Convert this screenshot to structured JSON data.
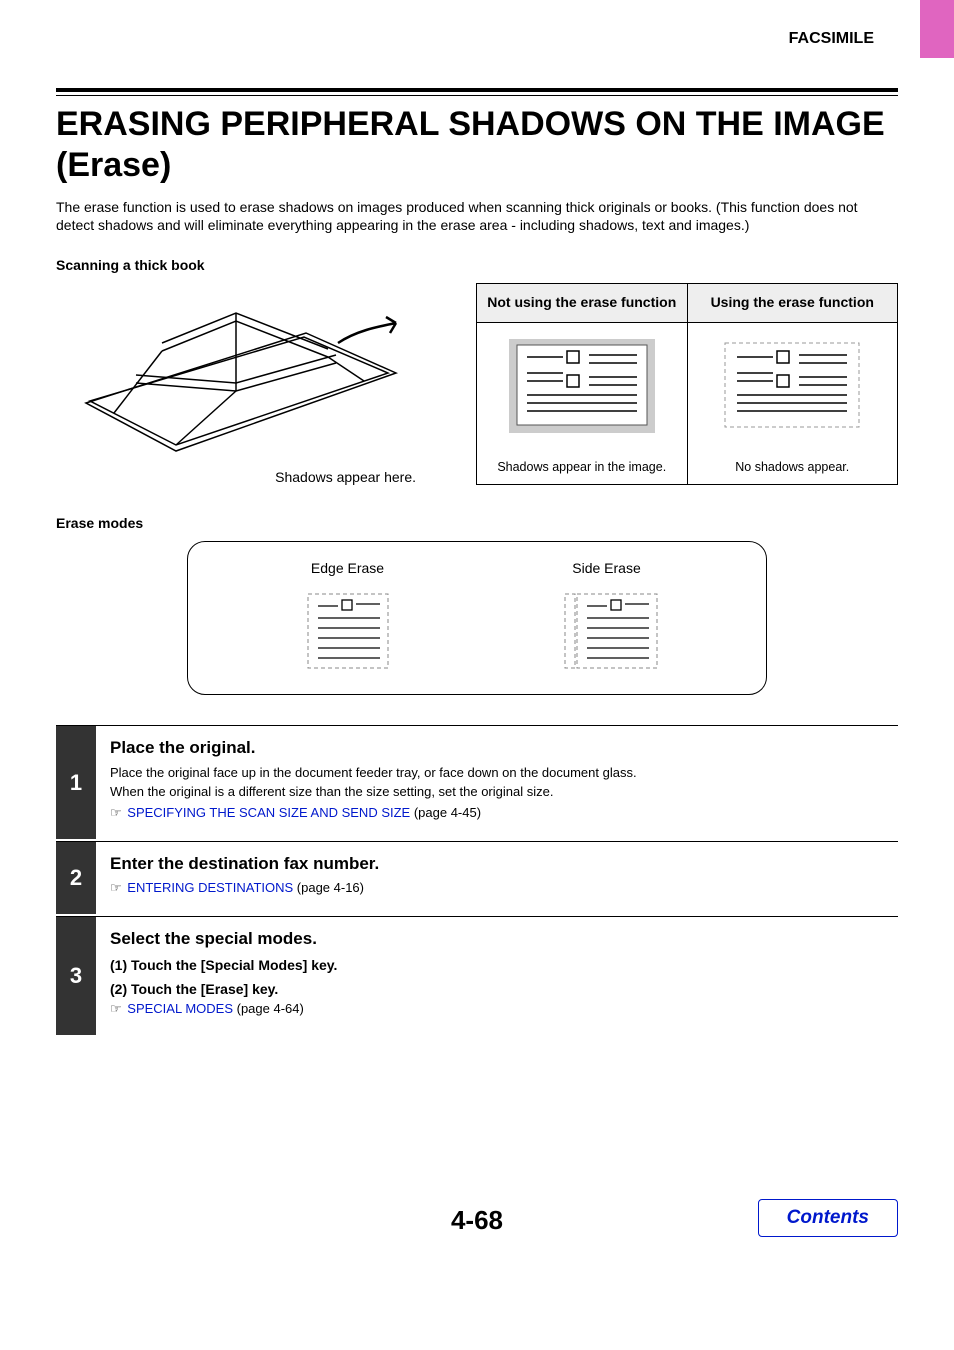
{
  "header": {
    "section": "FACSIMILE"
  },
  "title": "ERASING PERIPHERAL SHADOWS ON THE IMAGE (Erase)",
  "intro": "The erase function is used to erase shadows on images produced when scanning thick originals or books. (This function does not detect shadows and will eliminate everything appearing in the erase area - including shadows, text and images.)",
  "scan_label": "Scanning a thick book",
  "book_caption": "Shadows appear here.",
  "compare": {
    "col1_head": "Not using the erase function",
    "col2_head": "Using the erase function",
    "col1_cap": "Shadows appear in the image.",
    "col2_cap": "No shadows appear."
  },
  "erase_modes_label": "Erase modes",
  "modes": {
    "edge": "Edge Erase",
    "side": "Side Erase"
  },
  "steps": [
    {
      "num": "1",
      "title": "Place the original.",
      "lines": [
        "Place the original face up in the document feeder tray, or face down on the document glass.",
        "When the original is a different size than the size setting, set the original size."
      ],
      "link": {
        "text": "SPECIFYING THE SCAN SIZE AND SEND SIZE",
        "ref": " (page 4-45)"
      }
    },
    {
      "num": "2",
      "title": "Enter the destination fax number.",
      "lines": [],
      "link": {
        "text": "ENTERING DESTINATIONS",
        "ref": " (page 4-16)"
      }
    },
    {
      "num": "3",
      "title": "Select the special modes.",
      "lines": [],
      "subs": [
        "(1)  Touch the [Special Modes] key.",
        "(2)  Touch the [Erase] key."
      ],
      "link": {
        "text": "SPECIAL MODES",
        "ref": " (page 4-64)"
      }
    }
  ],
  "page_number": "4-68",
  "contents_label": "Contents"
}
